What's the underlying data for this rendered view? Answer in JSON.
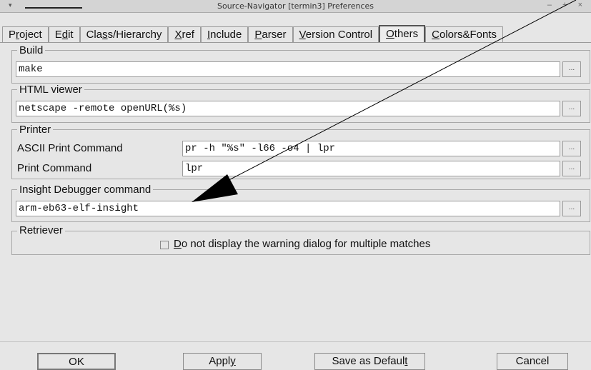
{
  "window": {
    "title": "Source-Navigator [termin3] Preferences",
    "menu_glyph": "▾",
    "controls": "– + ×"
  },
  "tabs": [
    {
      "pre": "P",
      "u": "r",
      "post": "oject"
    },
    {
      "pre": "E",
      "u": "d",
      "post": "it"
    },
    {
      "pre": "Cla",
      "u": "s",
      "post": "s/Hierarchy"
    },
    {
      "pre": "",
      "u": "X",
      "post": "ref"
    },
    {
      "pre": "",
      "u": "I",
      "post": "nclude"
    },
    {
      "pre": "",
      "u": "P",
      "post": "arser"
    },
    {
      "pre": "",
      "u": "V",
      "post": "ersion Control"
    },
    {
      "pre": "",
      "u": "O",
      "post": "thers"
    },
    {
      "pre": "",
      "u": "C",
      "post": "olors&Fonts"
    }
  ],
  "build": {
    "label": "Build",
    "value": "make",
    "browse": "..."
  },
  "html_viewer": {
    "label": "HTML viewer",
    "value": "netscape -remote openURL(%s)",
    "browse": "..."
  },
  "printer": {
    "label": "Printer",
    "ascii_label": "ASCII Print Command",
    "ascii_value": "pr -h \"%s\" -l66 -o4 | lpr",
    "print_label": "Print Command",
    "print_value": "lpr",
    "browse": "..."
  },
  "insight": {
    "label": "Insight Debugger command",
    "value": "arm-eb63-elf-insight",
    "browse": "..."
  },
  "retriever": {
    "label": "Retriever",
    "checkbox_u": "D",
    "checkbox_rest": "o not display the warning dialog for multiple matches",
    "checked": false
  },
  "buttons": {
    "ok": "OK",
    "apply_pre": "Appl",
    "apply_u": "y",
    "save_pre": "Save as Defaul",
    "save_u": "t",
    "cancel": "Cancel"
  },
  "colors": {
    "annotation_line": "#000000"
  }
}
